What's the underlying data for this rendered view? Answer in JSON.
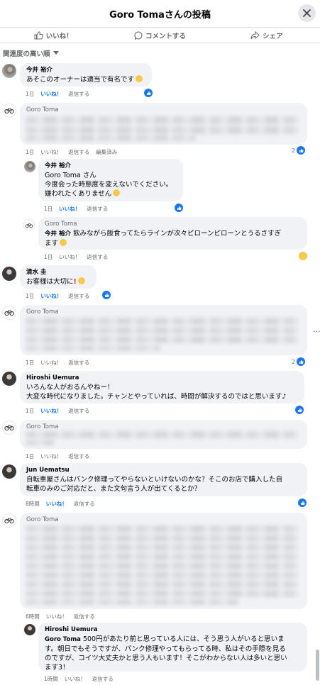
{
  "header": {
    "title": "Goro Tomaさんの投稿"
  },
  "actions": {
    "like": "いいね！",
    "comment": "コメントする",
    "share": "シェア"
  },
  "sort": {
    "label": "関連度の高い順"
  },
  "comments": [
    {
      "name": "今井 裕介",
      "text": "あそこのオーナーは適当で有名です",
      "time": "1日",
      "like": "いいね！",
      "reply": "返信する"
    },
    {
      "name": "Goro Toma",
      "time": "1日",
      "like": "いいね！",
      "reply": "返信する",
      "edited": "編集済み",
      "reactions": "2"
    },
    {
      "name": "今井 裕介",
      "line1": "Goro Toma さん",
      "line2": "今度会った時態度を変えないでください。",
      "line3": "嫌われたくありません",
      "time": "1日",
      "like": "いいね！",
      "reply": "返信する"
    },
    {
      "name": "Goro Toma",
      "mention": "今井 裕介",
      "text": "飲みながら飯食ってたらラインが次々ピローンピローンとうるさすぎ",
      "text2": "ます",
      "time": "1日",
      "like": "いいね！",
      "reply": "返信する"
    },
    {
      "name": "清水 圭",
      "text": "お客様は大切に",
      "time": "1日",
      "like": "いいね！",
      "reply": "返信する"
    },
    {
      "name": "Goro Toma",
      "time": "1日",
      "like": "いいね！",
      "reply": "返信する",
      "reactions": "2"
    },
    {
      "name": "Hiroshi Uemura",
      "line1": "いろんな人がおるんやねー！",
      "line2": "大変な時代になりました。チャンとやっていれば、時間が解決するのではと思います♪",
      "time": "1日",
      "like": "いいね！",
      "reply": "返信する"
    },
    {
      "name": "Goro Toma",
      "time": "1日",
      "like": "いいね！",
      "reply": "返信する"
    },
    {
      "name": "Jun Uematsu",
      "line1": "自転車屋さんはパンク修理ってやらないといけないのかな？そこのお店で購入した自",
      "line2": "転車のみのご対応だと、また文句言う人が出てくるとか？",
      "time": "8時間",
      "like": "いいね！",
      "reply": "返信する"
    },
    {
      "name": "Goro Toma",
      "time": "6時間",
      "like": "いいね！",
      "reply": "返信する"
    },
    {
      "name": "Hiroshi Uemura",
      "mention": "Goro Toma",
      "line1": "500円があたり前と思っている人には、そう思う人がいると思いま",
      "line2": "す。朝日でもそうですが、パンク修理やってもらってる時、私はその手際を見る",
      "line3": "のですが、コイツ大丈夫かと思う人もいます！そこがわからない人は多いと思い",
      "line4": "ます3！",
      "time": "1時間",
      "like": "いいね！",
      "reply": "返信する"
    }
  ],
  "colors": {
    "accent": "#1877f2",
    "bubble": "#f0f2f5",
    "muted": "#65676b"
  }
}
